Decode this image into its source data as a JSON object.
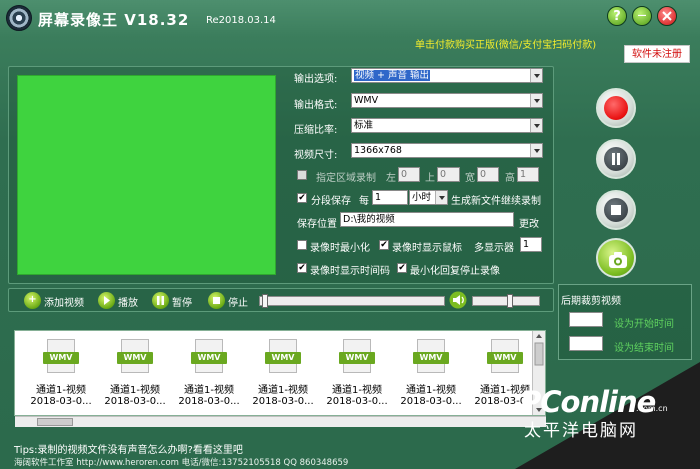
{
  "window": {
    "title": "屏幕录像王 V18.32",
    "release": "Re2018.03.14",
    "help_label": "?",
    "minimize_label": "—"
  },
  "header": {
    "buy_link": "单击付款购买正版(微信/支付宝扫码付款)",
    "unregistered_badge": "软件未注册"
  },
  "settings": {
    "output_option": {
      "label": "输出选项:",
      "value": "视频 + 声音 输出"
    },
    "output_format": {
      "label": "输出格式:",
      "value": "WMV"
    },
    "compression": {
      "label": "压缩比率:",
      "value": "标准"
    },
    "video_size": {
      "label": "视频尺寸:",
      "value": "1366x768"
    },
    "region": {
      "label": "指定区域录制",
      "left_label": "左",
      "left_value": "0",
      "top_label": "上",
      "top_value": "0",
      "width_label": "宽",
      "width_value": "0",
      "height_label": "高",
      "height_value": "1"
    },
    "segment": {
      "label": "分段保存",
      "every_label": "每",
      "count": "1",
      "unit": "小时",
      "suffix": "生成新文件继续录制"
    },
    "save_location": {
      "label": "保存位置",
      "value": "D:\\我的视频",
      "change_label": "更改"
    },
    "options": {
      "minimize_when_recording": "录像时最小化",
      "show_cursor": "录像时显示鼠标",
      "multi_monitor_label": "多显示器",
      "multi_monitor_value": "1",
      "show_timecode": "录像时显示时间码",
      "stop_on_restore": "最小化回复停止录像"
    }
  },
  "toolbar": {
    "add_video": "添加视频",
    "play": "播放",
    "pause": "暂停",
    "stop": "停止"
  },
  "playback": {
    "progress": 0.0,
    "volume": 0.55
  },
  "post_edit": {
    "title": "后期裁剪视频",
    "set_start": "设为开始时间",
    "set_end": "设为结束时间"
  },
  "files": [
    {
      "badge": "WMV",
      "name": "通道1-视频",
      "date": "2018-03-0..."
    },
    {
      "badge": "WMV",
      "name": "通道1-视频",
      "date": "2018-03-0..."
    },
    {
      "badge": "WMV",
      "name": "通道1-视频",
      "date": "2018-03-0..."
    },
    {
      "badge": "WMV",
      "name": "通道1-视频",
      "date": "2018-03-0..."
    },
    {
      "badge": "WMV",
      "name": "通道1-视频",
      "date": "2018-03-0..."
    },
    {
      "badge": "WMV",
      "name": "通道1-视频",
      "date": "2018-03-0..."
    },
    {
      "badge": "WMV",
      "name": "通道1-视频",
      "date": "2018-03-0..."
    }
  ],
  "tips": "Tips:录制的视频文件没有声音怎么办啊?看看这里吧",
  "footer": "海阔软件工作室 http://www.heroren.com  电话/微信:13752105518  QQ 860348659",
  "watermark": {
    "brand": "PConline",
    "domain": ".com.cn",
    "cn": "太平洋电脑网"
  },
  "colors": {
    "background": "#2f6e50",
    "preview": "#3fd33f",
    "accent_yellow": "#f5ee2b",
    "record_red": "#e81010",
    "label_green": "#5fd15f"
  }
}
